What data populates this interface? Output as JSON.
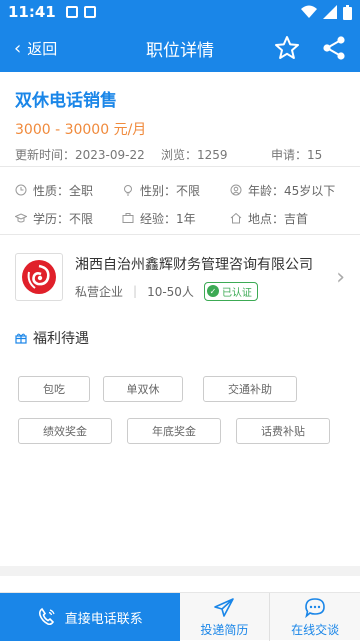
{
  "status_bar": {
    "time": "11:41"
  },
  "nav": {
    "back_label": "返回",
    "title": "职位详情"
  },
  "job": {
    "title": "双休电话销售",
    "salary": "3000 - 30000 元/月",
    "updated": "更新时间：2023-09-22",
    "views": "浏览：1259",
    "applies": "申请：15"
  },
  "attributes": [
    {
      "label": "性质：全职",
      "icon": "clock-icon"
    },
    {
      "label": "性别：不限",
      "icon": "bulb-icon"
    },
    {
      "label": "年龄：45岁以下",
      "icon": "person-icon"
    },
    {
      "label": "学历：不限",
      "icon": "cap-icon"
    },
    {
      "label": "经验：1年",
      "icon": "briefcase-icon"
    },
    {
      "label": "地点：吉首",
      "icon": "home-icon"
    }
  ],
  "company": {
    "name": "湘西自治州鑫辉财务管理咨询有限公司",
    "type": "私营企业",
    "size": "10-50人",
    "verified": "已认证"
  },
  "welfare": {
    "title": "福利待遇",
    "tags": [
      "包吃",
      "单双休",
      "交通补助",
      "绩效奖金",
      "年底奖金",
      "话费补贴"
    ]
  },
  "bottom": {
    "call": "直接电话联系",
    "resume": "投递简历",
    "chat": "在线交谈"
  },
  "colors": {
    "primary": "#1a86e8",
    "salary": "#f08a3c",
    "verified": "#3caa54"
  }
}
